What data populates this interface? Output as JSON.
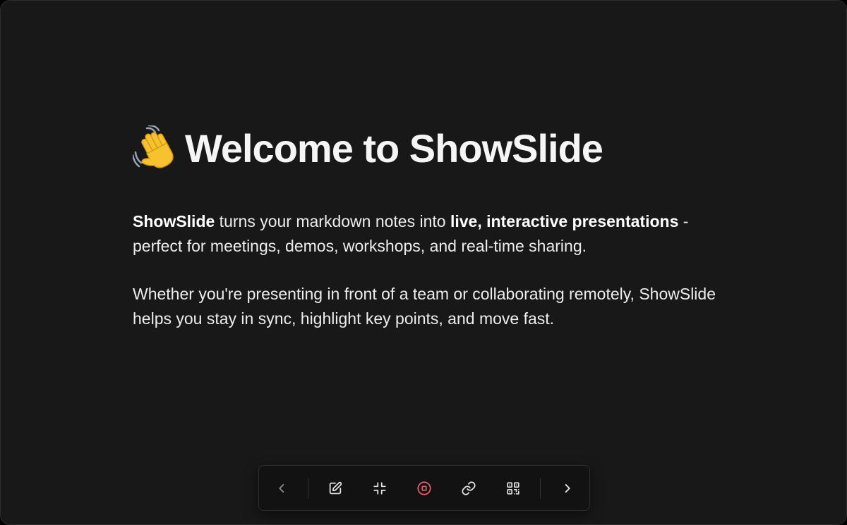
{
  "slide": {
    "emoji": "waving-hand-emoji",
    "title": "Welcome to ShowSlide",
    "paragraph1": {
      "brand": "ShowSlide",
      "text1": " turns your markdown notes into ",
      "highlight": "live, interactive presentations",
      "text2": " - perfect for meetings, demos, workshops, and real-time sharing."
    },
    "paragraph2": "Whether you're presenting in front of a team or collaborating remotely, ShowSlide helps you stay in sync, highlight key points, and move fast."
  },
  "toolbar": {
    "buttons": [
      {
        "icon": "chevron-left-icon"
      },
      {
        "icon": "edit-icon"
      },
      {
        "icon": "minimize-icon"
      },
      {
        "icon": "stop-icon",
        "color": "#e5636b"
      },
      {
        "icon": "link-icon"
      },
      {
        "icon": "qr-code-icon"
      },
      {
        "icon": "chevron-right-icon"
      }
    ]
  },
  "colors": {
    "background": "#181818",
    "text": "#f2f2f2",
    "icon": "#e6e6e6",
    "icon_muted": "#8a8a8a",
    "stop_accent": "#e5636b"
  }
}
